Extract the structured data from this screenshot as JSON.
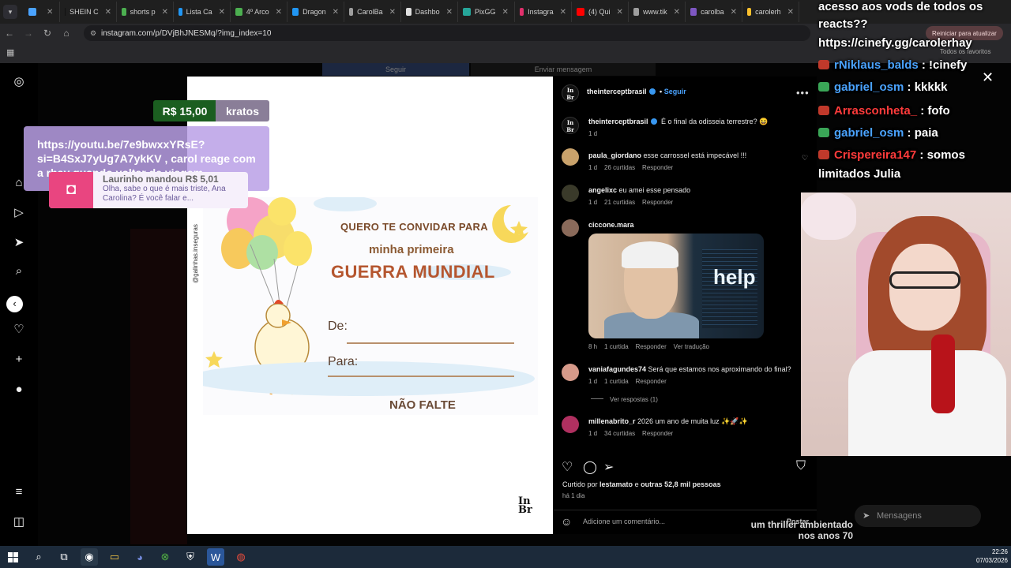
{
  "browser": {
    "tabs": [
      {
        "label": "",
        "favicon_color": "#4aa3ff"
      },
      {
        "label": "SHEIN C",
        "favicon_color": "#111111"
      },
      {
        "label": "shorts p",
        "favicon_color": "#4caf50"
      },
      {
        "label": "Lista Ca",
        "favicon_color": "#2196f3"
      },
      {
        "label": "4º Arco",
        "favicon_color": "#4caf50"
      },
      {
        "label": "Dragon",
        "favicon_color": "#2196f3"
      },
      {
        "label": "CarolBa",
        "favicon_color": "#9e9e9e"
      },
      {
        "label": "Dashbo",
        "favicon_color": "#e0e0e0"
      },
      {
        "label": "PixGG",
        "favicon_color": "#26a69a"
      },
      {
        "label": "Instagra",
        "favicon_color": "#e1306c"
      },
      {
        "label": "(4) Qui",
        "favicon_color": "#ff0000"
      },
      {
        "label": "www.tik",
        "favicon_color": "#9e9e9e"
      },
      {
        "label": "carolba",
        "favicon_color": "#7e57c2"
      },
      {
        "label": "carolerh",
        "favicon_color": "#fbc02d"
      }
    ],
    "url": "instagram.com/p/DVjBhJNESMq/?img_index=10",
    "restart_button": "Reiniciar para atualizar",
    "favorites_folder": "Todos os favoritos"
  },
  "instagram": {
    "top_follow_button": "Seguir",
    "top_message_button": "Enviar mensagem",
    "post_author": "theinterceptbrasil",
    "follow_label": "Seguir",
    "caption_author": "theinterceptbrasil",
    "caption_text": "É o final da odisseia terrestre? 😆",
    "caption_time": "1 d",
    "comments": [
      {
        "user": "paula_giordano",
        "text": "esse carrossel está impecável !!!",
        "time": "1 d",
        "likes": "26 curtidas",
        "reply": "Responder"
      },
      {
        "user": "angelixc",
        "text": "eu amei esse pensado",
        "time": "1 d",
        "likes": "21 curtidas",
        "reply": "Responder"
      },
      {
        "user": "ciccone.mara",
        "text": "",
        "time": "8 h",
        "likes": "1 curtida",
        "reply": "Responder",
        "translate": "Ver tradução",
        "meme_text": "help"
      },
      {
        "user": "vaniafagundes74",
        "text": "Será que estamos nos aproximando do final?",
        "time": "1 d",
        "likes": "1 curtida",
        "reply": "Responder",
        "view_replies": "Ver respostas (1)"
      },
      {
        "user": "millenabrito_r",
        "text": "2026 um ano de muita luz ✨🚀✨",
        "time": "1 d",
        "likes": "34 curtidas",
        "reply": "Responder"
      }
    ],
    "liked_by_prefix": "Curtido por ",
    "liked_by_user": "lestamato",
    "liked_by_mid": " e ",
    "liked_by_others": "outras 52,8 mil pessoas",
    "post_age": "há 1 dia",
    "comment_placeholder": "Adicione um comentário...",
    "post_button": "Postar"
  },
  "invite_image": {
    "line1": "QUERO TE CONVIDAR PARA",
    "line2": "minha primeira",
    "line3": "GUERRA MUNDIAL",
    "de": "De:",
    "para": "Para:",
    "footer": "NÃO FALTE",
    "handle": "@galinhas.inseguras",
    "brand_logo": "In Br"
  },
  "stream_overlay": {
    "donation_amount": "R$ 15,00",
    "donation_name": "kratos",
    "donation_message": "https://youtu.be/7e9bwxxYRsE?si=B4SxJ7yUg7A7ykKV , carol reage com a rhay quando voltar de viagem...",
    "alert_who": "Laurinho mandou R$ 5,01",
    "alert_text": "Olha, sabe o que é mais triste, Ana Carolina? É você falar e...",
    "chat": [
      {
        "user": "",
        "text": "acesso aos vods de todos os",
        "user_color": "#ffffff"
      },
      {
        "user": "",
        "text": "reacts??",
        "user_color": "#ffffff"
      },
      {
        "user": "",
        "text": "https://cinefy.gg/carolerhay",
        "user_color": "#ffffff"
      },
      {
        "user": "rNiklaus_balds",
        "text": " : !cinefy",
        "user_color": "#4aa3ff"
      },
      {
        "user": "gabriel_osm",
        "text": " : kkkkk",
        "user_color": "#4aa3ff"
      },
      {
        "user": "Arrasconheta_",
        "text": " : fofo",
        "user_color": "#ff3b3b"
      },
      {
        "user": "gabriel_osm",
        "text": " : paia",
        "user_color": "#4aa3ff"
      },
      {
        "user": "Crispereira147",
        "text": " : somos",
        "user_color": "#ff3b3b"
      },
      {
        "user": "",
        "text": "limitados Julia",
        "user_color": "#ffffff"
      }
    ],
    "messages_label": "Mensagens",
    "bottom_caption": "um thriller ambientado nos anos 70"
  },
  "taskbar": {
    "time": "22:26",
    "date": "07/03/2026"
  }
}
